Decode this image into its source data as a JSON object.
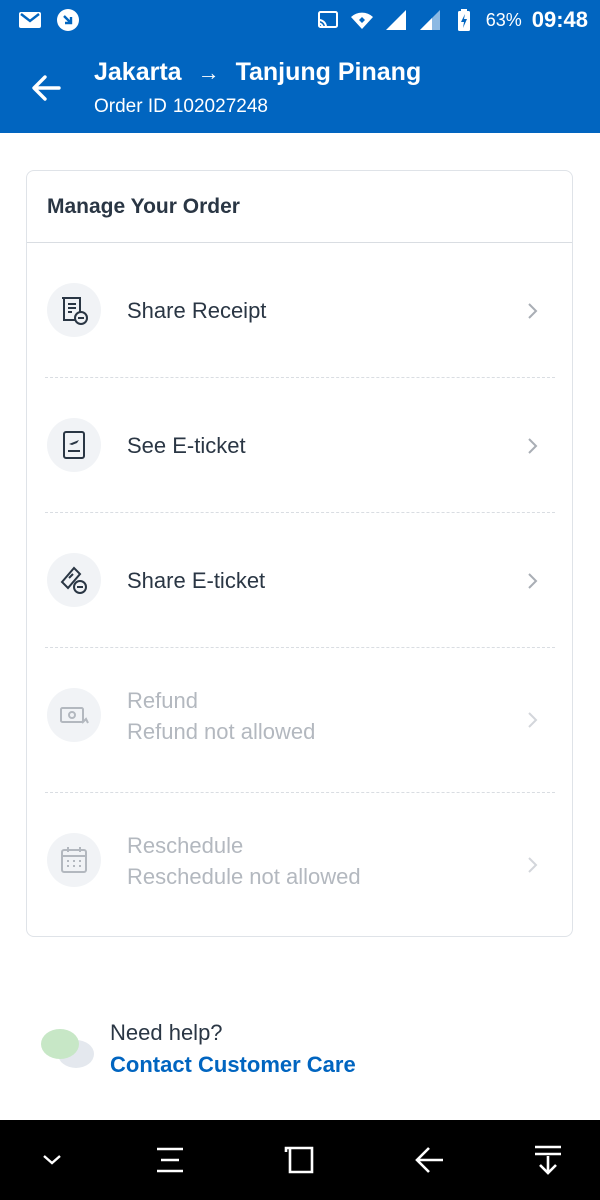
{
  "status_bar": {
    "battery": "63%",
    "time": "09:48",
    "icons": [
      "gmail-icon",
      "app-notification-icon",
      "cast-icon",
      "wifi-icon",
      "signal-icon",
      "signal-icon",
      "battery-charging-icon"
    ]
  },
  "header": {
    "origin": "Jakarta",
    "arrow": "→",
    "destination": "Tanjung Pinang",
    "order_id_label": "Order ID",
    "order_id": "102027248"
  },
  "card": {
    "title": "Manage Your Order",
    "items": [
      {
        "label": "Share Receipt",
        "icon": "share-receipt-icon",
        "enabled": true
      },
      {
        "label": "See E-ticket",
        "icon": "eticket-icon",
        "enabled": true
      },
      {
        "label": "Share E-ticket",
        "icon": "share-eticket-icon",
        "enabled": true
      },
      {
        "label": "Refund",
        "sub": "Refund not allowed",
        "icon": "refund-icon",
        "enabled": false
      },
      {
        "label": "Reschedule",
        "sub": "Reschedule not allowed",
        "icon": "calendar-icon",
        "enabled": false
      }
    ]
  },
  "help": {
    "question": "Need help?",
    "link": "Contact Customer Care"
  },
  "nav_bar": {
    "icons": [
      "chevron-down-icon",
      "menu-icon",
      "recent-apps-icon",
      "back-icon",
      "notifications-down-icon"
    ]
  },
  "colors": {
    "brand_blue": "#0165c0",
    "text_dark": "#2a3644",
    "text_disabled": "#b3b8bf"
  }
}
